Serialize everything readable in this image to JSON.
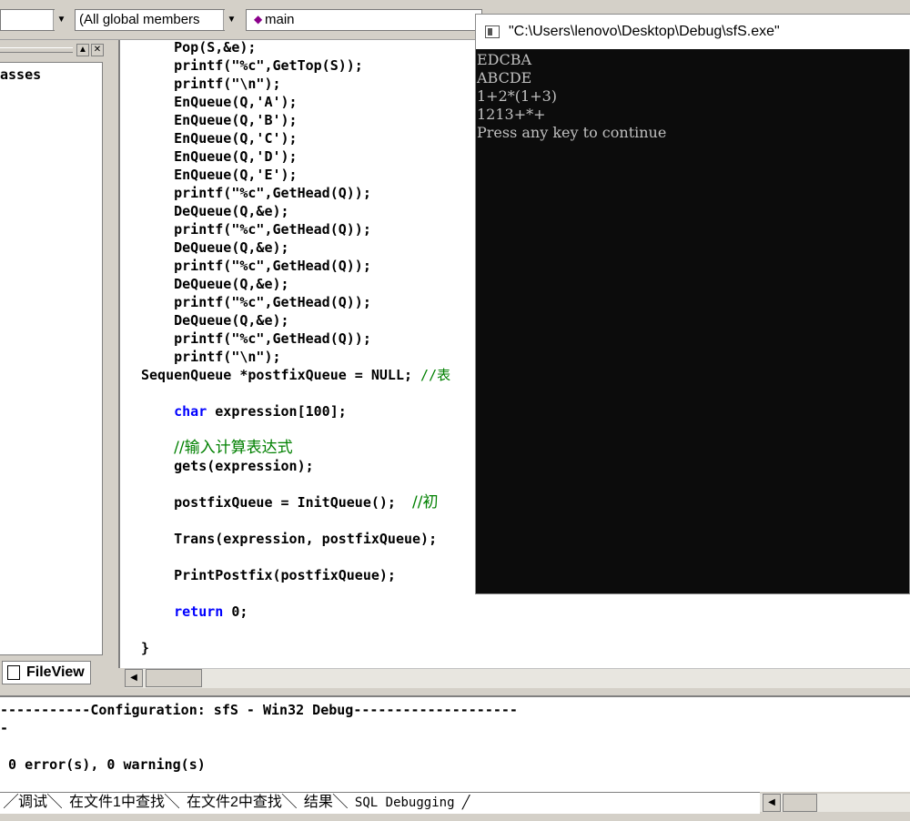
{
  "toolbar": {
    "class_combo_value": "",
    "members_combo_value": "(All global members",
    "function_combo_value": "main"
  },
  "left_panel": {
    "tree_text": "asses",
    "fileview_tab_label": "FileView"
  },
  "editor": {
    "lines": [
      {
        "indent": "    ",
        "text": "Pop(S,&e);"
      },
      {
        "indent": "    ",
        "text": "printf(\"%c\",GetTop(S));"
      },
      {
        "indent": "    ",
        "text": "printf(\"\\n\");"
      },
      {
        "indent": "    ",
        "text": "EnQueue(Q,'A');"
      },
      {
        "indent": "    ",
        "text": "EnQueue(Q,'B');"
      },
      {
        "indent": "    ",
        "text": "EnQueue(Q,'C');"
      },
      {
        "indent": "    ",
        "text": "EnQueue(Q,'D');"
      },
      {
        "indent": "    ",
        "text": "EnQueue(Q,'E');"
      },
      {
        "indent": "    ",
        "text": "printf(\"%c\",GetHead(Q));"
      },
      {
        "indent": "    ",
        "text": "DeQueue(Q,&e);"
      },
      {
        "indent": "    ",
        "text": "printf(\"%c\",GetHead(Q));"
      },
      {
        "indent": "    ",
        "text": "DeQueue(Q,&e);"
      },
      {
        "indent": "    ",
        "text": "printf(\"%c\",GetHead(Q));"
      },
      {
        "indent": "    ",
        "text": "DeQueue(Q,&e);"
      },
      {
        "indent": "    ",
        "text": "printf(\"%c\",GetHead(Q));"
      },
      {
        "indent": "    ",
        "text": "DeQueue(Q,&e);"
      },
      {
        "indent": "    ",
        "text": "printf(\"%c\",GetHead(Q));"
      },
      {
        "indent": "    ",
        "text": "printf(\"\\n\");"
      }
    ],
    "line_postfix_decl": "SequenQueue *postfixQueue = NULL; ",
    "line_postfix_decl_comment": "//表",
    "line_char_kw": "char",
    "line_char_rest": " expression[100];",
    "line_comment_input": "//输入计算表达式",
    "line_gets": "gets(expression);",
    "line_init": "postfixQueue = InitQueue();  ",
    "line_init_comment": "//初",
    "line_trans": "Trans(expression, postfixQueue);",
    "line_print": "PrintPostfix(postfixQueue);",
    "line_return_kw": "return",
    "line_return_rest": " 0;",
    "line_close": "}"
  },
  "console": {
    "title": "\"C:\\Users\\lenovo\\Desktop\\Debug\\sfS.exe\"",
    "lines": [
      "EDCBA",
      "ABCDE",
      "1+2*(1+3)",
      "1213+*+",
      "Press any key to continue"
    ]
  },
  "output": {
    "config_line": "-----------Configuration: sfS - Win32 Debug--------------------",
    "dash_line": "-",
    "result_line": " 0 error(s), 0 warning(s)",
    "tabs": [
      "调试",
      "在文件1中查找",
      "在文件2中查找",
      "结果",
      "SQL Debugging"
    ]
  }
}
